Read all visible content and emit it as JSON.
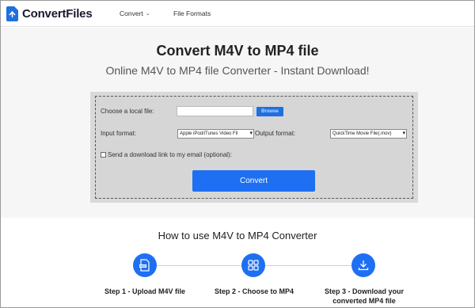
{
  "header": {
    "brand": "ConvertFiles",
    "nav": [
      {
        "label": "Convert",
        "has_dropdown": true
      },
      {
        "label": "File Formats",
        "has_dropdown": false
      }
    ]
  },
  "main": {
    "title": "Convert M4V to MP4 file",
    "subtitle": "Online M4V to MP4 file Converter - Instant Download!"
  },
  "form": {
    "file_label": "Choose a local file:",
    "file_value": "",
    "browse_label": "Browse",
    "input_format_label": "Input format:",
    "input_format_value": "Apple iPod/iTunes Video Fil",
    "output_format_label": "Output format:",
    "output_format_value": "QuickTime Movie File(.mov)",
    "email_checkbox_label": "Send a download link to my email (optional):",
    "email_checked": false,
    "convert_label": "Convert"
  },
  "howto": {
    "title": "How to use M4V to MP4 Converter",
    "steps": [
      {
        "label": "Step 1 - Upload M4V file",
        "icon": "upload-file-icon"
      },
      {
        "label": "Step 2 - Choose to MP4",
        "icon": "grid-icon"
      },
      {
        "label_line1": "Step 3 - Download your",
        "label_line2": "converted MP4 file",
        "icon": "download-icon"
      }
    ]
  },
  "colors": {
    "accent": "#1e6ff2",
    "band": "#f6f6f6",
    "form_bg": "#d6d6d6"
  }
}
